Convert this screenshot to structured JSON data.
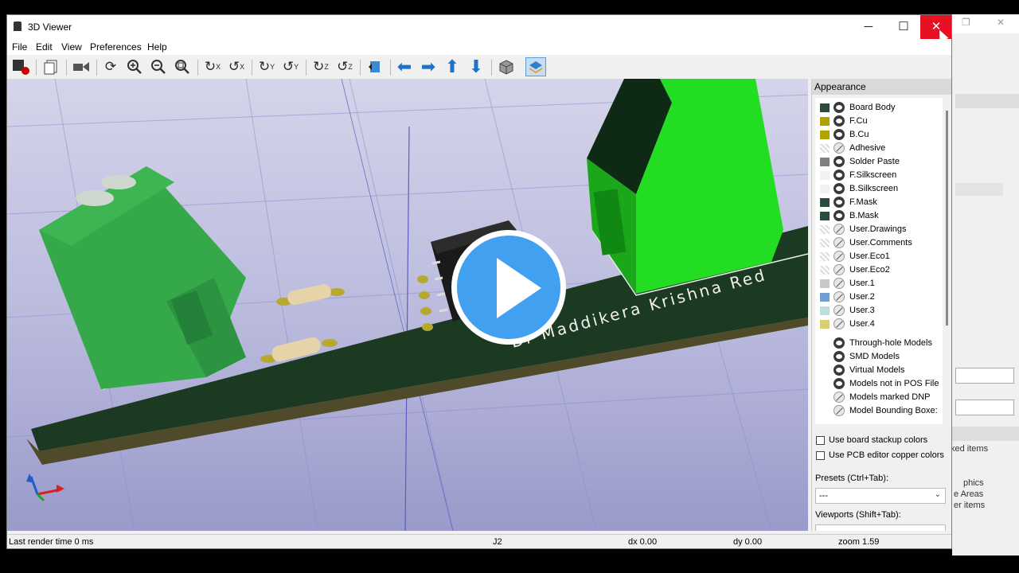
{
  "window": {
    "title": "3D Viewer"
  },
  "menu": [
    "File",
    "Edit",
    "View",
    "Preferences",
    "Help"
  ],
  "toolbar": {
    "zoom_in_icon": "zoom-in-icon",
    "zoom_out_icon": "zoom-out-icon",
    "rotate_labels": [
      "X",
      "X",
      "Y",
      "Y",
      "Z",
      "Z"
    ]
  },
  "viewport": {
    "board_text": "Dr Maddikera Krishna Red",
    "colors": {
      "board": "#1c3a22",
      "terminal": "#35a84a",
      "terminal_bright": "#22dd22",
      "ic": "#1a1a1a",
      "resistor": "#e7d3a8"
    }
  },
  "panel": {
    "title": "Appearance",
    "layers": [
      {
        "name": "Board Body",
        "color": "#2f4a3a",
        "visible": true
      },
      {
        "name": "F.Cu",
        "color": "#b0a300",
        "visible": true
      },
      {
        "name": "B.Cu",
        "color": "#b0a300",
        "visible": true
      },
      {
        "name": "Adhesive",
        "color": "",
        "visible": false
      },
      {
        "name": "Solder Paste",
        "color": "#808080",
        "visible": true
      },
      {
        "name": "F.Silkscreen",
        "color": "#f2f2f2",
        "visible": true
      },
      {
        "name": "B.Silkscreen",
        "color": "#f2f2f2",
        "visible": true
      },
      {
        "name": "F.Mask",
        "color": "#2d4d3c",
        "visible": true
      },
      {
        "name": "B.Mask",
        "color": "#2d4d3c",
        "visible": true
      },
      {
        "name": "User.Drawings",
        "color": "",
        "visible": false
      },
      {
        "name": "User.Comments",
        "color": "",
        "visible": false
      },
      {
        "name": "User.Eco1",
        "color": "",
        "visible": false
      },
      {
        "name": "User.Eco2",
        "color": "",
        "visible": false
      },
      {
        "name": "User.1",
        "color": "#c8c8c8",
        "visible": false
      },
      {
        "name": "User.2",
        "color": "#6f9fd0",
        "visible": false
      },
      {
        "name": "User.3",
        "color": "#b9e0dc",
        "visible": false
      },
      {
        "name": "User.4",
        "color": "#d8d070",
        "visible": false
      }
    ],
    "models": [
      {
        "name": "Through-hole Models",
        "visible": true
      },
      {
        "name": "SMD Models",
        "visible": true
      },
      {
        "name": "Virtual Models",
        "visible": true
      },
      {
        "name": "Models not in POS File",
        "visible": true
      },
      {
        "name": "Models marked DNP",
        "visible": false
      },
      {
        "name": "Model Bounding Boxe:",
        "visible": false
      }
    ],
    "use_board_stackup": "Use board stackup colors",
    "use_pcb_editor": "Use PCB editor copper colors",
    "presets_label": "Presets (Ctrl+Tab):",
    "presets_value": "---",
    "viewports_label": "Viewports (Shift+Tab):",
    "viewports_value": "---"
  },
  "status": {
    "render_time": "Last render time 0 ms",
    "ref": "J2",
    "dx": "dx 0.00",
    "dy": "dy 0.00",
    "zoom": "zoom 1.59"
  },
  "background": {
    "items": [
      "ked items",
      "phics",
      "e Areas",
      "er items"
    ]
  }
}
